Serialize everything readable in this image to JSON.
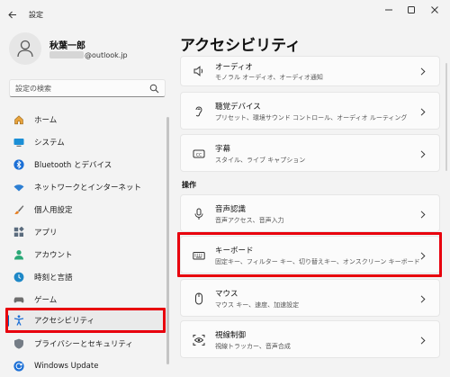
{
  "window": {
    "title": "設定"
  },
  "user": {
    "name": "秋葉一郎",
    "email_suffix": "@outlook.jp"
  },
  "search": {
    "placeholder": "設定の検索"
  },
  "sidebar": {
    "items": [
      {
        "label": "ホーム",
        "icon": "home-icon"
      },
      {
        "label": "システム",
        "icon": "display-icon"
      },
      {
        "label": "Bluetooth とデバイス",
        "icon": "bluetooth-icon"
      },
      {
        "label": "ネットワークとインターネット",
        "icon": "wifi-icon"
      },
      {
        "label": "個人用設定",
        "icon": "brush-icon"
      },
      {
        "label": "アプリ",
        "icon": "apps-icon"
      },
      {
        "label": "アカウント",
        "icon": "account-icon"
      },
      {
        "label": "時刻と言語",
        "icon": "globe-clock-icon"
      },
      {
        "label": "ゲーム",
        "icon": "gamepad-icon"
      },
      {
        "label": "アクセシビリティ",
        "icon": "accessibility-icon",
        "selected": true
      },
      {
        "label": "プライバシーとセキュリティ",
        "icon": "shield-icon"
      },
      {
        "label": "Windows Update",
        "icon": "update-icon"
      }
    ]
  },
  "main": {
    "title": "アクセシビリティ",
    "section_heading": "操作",
    "cards": [
      {
        "title": "オーディオ",
        "subtitle": "モノラル オーディオ、オーディオ通知",
        "icon": "speaker-icon"
      },
      {
        "title": "聴覚デバイス",
        "subtitle": "プリセット、環境サウンド コントロール、オーディオ ルーティング",
        "icon": "ear-icon"
      },
      {
        "title": "字幕",
        "subtitle": "スタイル、ライブ キャプション",
        "icon": "captions-icon"
      },
      {
        "title": "音声認識",
        "subtitle": "音声アクセス、音声入力",
        "icon": "microphone-icon"
      },
      {
        "title": "キーボード",
        "subtitle": "固定キー、フィルター キー、切り替えキー、オンスクリーン キーボード",
        "icon": "keyboard-icon"
      },
      {
        "title": "マウス",
        "subtitle": "マウス キー、速度、加速設定",
        "icon": "mouse-icon"
      },
      {
        "title": "視線制御",
        "subtitle": "視線トラッカー、音声合成",
        "icon": "eye-control-icon"
      }
    ]
  },
  "colors": {
    "accent": "#0067c0",
    "highlight": "#e8000d"
  }
}
